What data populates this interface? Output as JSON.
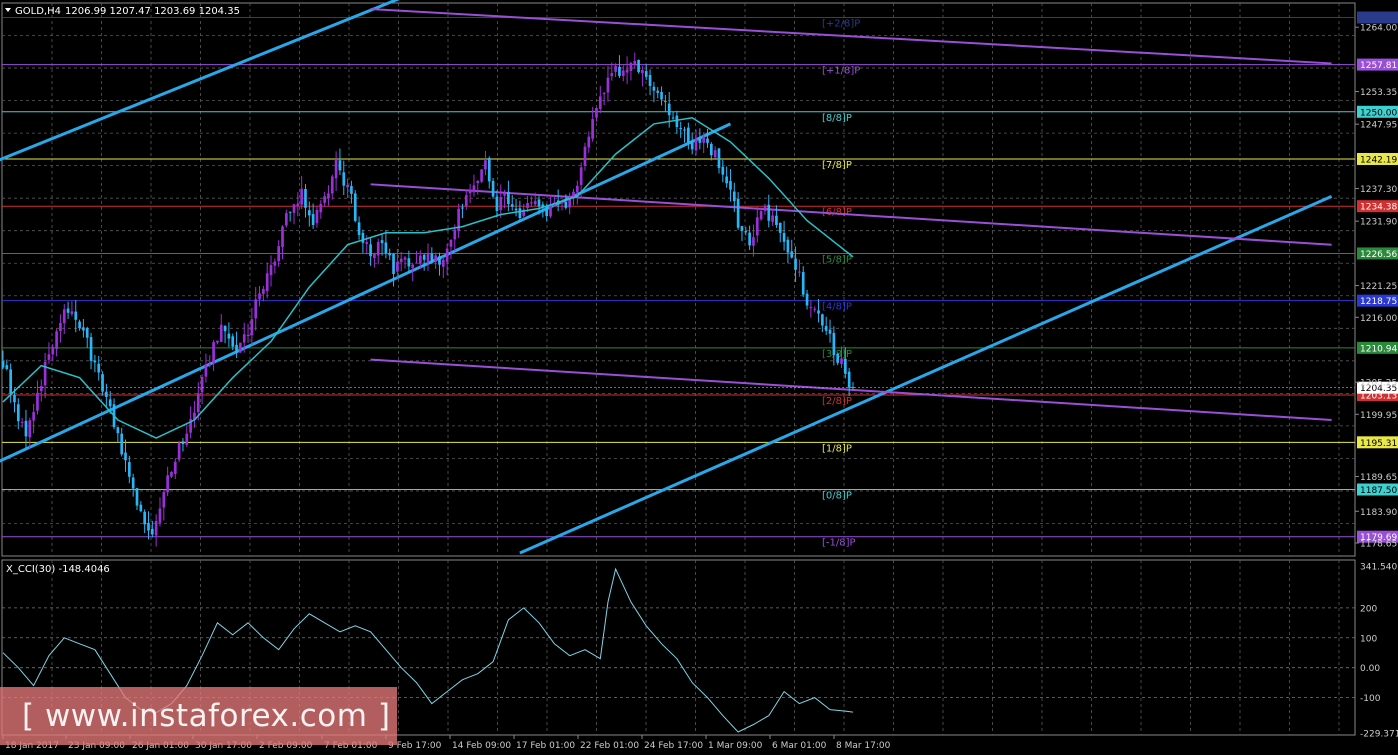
{
  "header": {
    "symbol_tf": "GOLD,H4",
    "ohlc": "1206.99 1207.47 1203.69 1204.35"
  },
  "indicator": {
    "label": "X_CCI(30) -148.4046",
    "value": -148.4046
  },
  "watermark": "[ www.instaforex.com ]",
  "colors": {
    "bull": "#9b30d9",
    "bear": "#29b6f6",
    "trend_channel": "#28a8e8",
    "regression_channel": "#9a4fd8",
    "moving_average": "#29c0c8",
    "cci_line": "#7fd4e8",
    "grid": "#5a5a5a"
  },
  "chart_data": [
    {
      "type": "candlestick",
      "title": "GOLD,H4",
      "ylim": [
        1176.5,
        1268.0
      ],
      "yticks": [
        "1264.00",
        "1253.35",
        "1247.95",
        "1237.30",
        "1231.90",
        "1221.25",
        "1216.00",
        "1205.25",
        "1199.95",
        "1189.65",
        "1183.90",
        "1178.65"
      ],
      "xticks": [
        "18 Jan 2017",
        "23 Jan 09:00",
        "26 Jan 01:00",
        "30 Jan 17:00",
        "2 Feb 09:00",
        "7 Feb 01:00",
        "9 Feb 17:00",
        "14 Feb 09:00",
        "17 Feb 01:00",
        "22 Feb 01:00",
        "24 Feb 17:00",
        "1 Mar 09:00",
        "6 Mar 01:00",
        "8 Mar 17:00"
      ],
      "murrey_levels": [
        {
          "label": "[+2/8]P",
          "price": 1265.6,
          "color": "#2a3a8c",
          "tag": ""
        },
        {
          "label": "[+1/8]P",
          "price": 1257.81,
          "color": "#9a4fd8",
          "tag": "1257.81"
        },
        {
          "label": "[8/8]P",
          "price": 1250.0,
          "color": "#3fd0d0",
          "tag": "1250.00"
        },
        {
          "label": "[7/8]P",
          "price": 1242.19,
          "color": "#e8e84a",
          "tag": "1242.19"
        },
        {
          "label": "[6/8]P",
          "price": 1234.38,
          "color": "#d03030",
          "tag": "1234.38"
        },
        {
          "label": "[5/8]P",
          "price": 1226.56,
          "color": "#2a8a3a",
          "tag": "1226.56"
        },
        {
          "label": "[4/8]P",
          "price": 1218.75,
          "color": "#2a3ad0",
          "tag": "1218.75"
        },
        {
          "label": "[3/8]P",
          "price": 1210.94,
          "color": "#2a8a3a",
          "tag": "1210.94"
        },
        {
          "label": "[2/8]P",
          "price": 1203.13,
          "color": "#d03030",
          "tag": "1203.13"
        },
        {
          "label": "[1/8]P",
          "price": 1195.31,
          "color": "#e8e84a",
          "tag": "1195.31"
        },
        {
          "label": "[0/8]P",
          "price": 1187.5,
          "color": "#3fd0d0",
          "tag": "1187.50"
        },
        {
          "label": "[-1/8]P",
          "price": 1179.69,
          "color": "#9a4fd8",
          "tag": "1179.69"
        }
      ],
      "current_price": "1204.35",
      "close_path": [
        [
          0,
          1209
        ],
        [
          3,
          1202
        ],
        [
          6,
          1196
        ],
        [
          9,
          1203
        ],
        [
          12,
          1210
        ],
        [
          15,
          1216
        ],
        [
          18,
          1217
        ],
        [
          21,
          1213
        ],
        [
          24,
          1208
        ],
        [
          27,
          1202
        ],
        [
          30,
          1196
        ],
        [
          33,
          1190
        ],
        [
          36,
          1183
        ],
        [
          39,
          1181
        ],
        [
          42,
          1187
        ],
        [
          45,
          1193
        ],
        [
          48,
          1197
        ],
        [
          51,
          1203
        ],
        [
          54,
          1209
        ],
        [
          57,
          1214
        ],
        [
          60,
          1210
        ],
        [
          63,
          1212
        ],
        [
          66,
          1218
        ],
        [
          69,
          1222
        ],
        [
          72,
          1228
        ],
        [
          75,
          1234
        ],
        [
          78,
          1236
        ],
        [
          81,
          1232
        ],
        [
          84,
          1236
        ],
        [
          87,
          1241
        ],
        [
          90,
          1238
        ],
        [
          93,
          1230
        ],
        [
          96,
          1226
        ],
        [
          99,
          1228
        ],
        [
          102,
          1224
        ],
        [
          105,
          1226
        ],
        [
          108,
          1225
        ],
        [
          111,
          1227
        ],
        [
          114,
          1224
        ],
        [
          117,
          1230
        ],
        [
          120,
          1235
        ],
        [
          123,
          1239
        ],
        [
          126,
          1241
        ],
        [
          129,
          1234
        ],
        [
          132,
          1236
        ],
        [
          135,
          1232
        ],
        [
          138,
          1235
        ],
        [
          141,
          1233
        ],
        [
          144,
          1236
        ],
        [
          147,
          1234
        ],
        [
          150,
          1238
        ],
        [
          153,
          1246
        ],
        [
          156,
          1252
        ],
        [
          159,
          1256
        ],
        [
          162,
          1257
        ],
        [
          165,
          1258
        ],
        [
          168,
          1256
        ],
        [
          171,
          1253
        ],
        [
          174,
          1250
        ],
        [
          177,
          1247
        ],
        [
          180,
          1244
        ],
        [
          183,
          1246
        ],
        [
          186,
          1243
        ],
        [
          189,
          1238
        ],
        [
          192,
          1232
        ],
        [
          195,
          1228
        ],
        [
          198,
          1234
        ],
        [
          201,
          1232
        ],
        [
          204,
          1228
        ],
        [
          207,
          1225
        ],
        [
          210,
          1219
        ],
        [
          213,
          1216
        ],
        [
          216,
          1212
        ],
        [
          219,
          1208
        ],
        [
          222,
          1204.35
        ]
      ],
      "moving_average_path": [
        [
          0,
          1202
        ],
        [
          10,
          1208
        ],
        [
          20,
          1206
        ],
        [
          30,
          1199
        ],
        [
          40,
          1196
        ],
        [
          50,
          1199
        ],
        [
          60,
          1206
        ],
        [
          70,
          1212
        ],
        [
          80,
          1221
        ],
        [
          90,
          1228
        ],
        [
          100,
          1230
        ],
        [
          110,
          1230
        ],
        [
          120,
          1231
        ],
        [
          130,
          1233
        ],
        [
          140,
          1234
        ],
        [
          150,
          1236
        ],
        [
          160,
          1243
        ],
        [
          170,
          1248
        ],
        [
          180,
          1249
        ],
        [
          190,
          1245
        ],
        [
          200,
          1239
        ],
        [
          210,
          1232
        ],
        [
          222,
          1226
        ]
      ],
      "trend_channel": {
        "upper": [
          [
            -5,
            1241
          ],
          [
            222,
            1299
          ]
        ],
        "middle": [
          [
            -5,
            1191
          ],
          [
            190,
            1248
          ]
        ],
        "lower": [
          [
            135,
            1177
          ],
          [
            347,
            1236
          ]
        ]
      },
      "regression_channel": {
        "upper": [
          [
            96,
            1267
          ],
          [
            347,
            1258
          ]
        ],
        "middle": [
          [
            96,
            1238
          ],
          [
            347,
            1228
          ]
        ],
        "lower": [
          [
            96,
            1209
          ],
          [
            347,
            1199
          ]
        ]
      }
    },
    {
      "type": "line",
      "title": "X_CCI(30) -148.4046",
      "ylim": [
        -225,
        360
      ],
      "yticks": [
        "341.5407",
        "200",
        "100",
        "0.00",
        "-100",
        "-229.3715"
      ],
      "levels": [
        200,
        100,
        0,
        -100
      ],
      "path": [
        [
          0,
          50
        ],
        [
          4,
          0
        ],
        [
          8,
          -60
        ],
        [
          12,
          40
        ],
        [
          16,
          100
        ],
        [
          20,
          80
        ],
        [
          24,
          60
        ],
        [
          28,
          -20
        ],
        [
          32,
          -100
        ],
        [
          36,
          -140
        ],
        [
          40,
          -150
        ],
        [
          44,
          -120
        ],
        [
          48,
          -60
        ],
        [
          52,
          40
        ],
        [
          56,
          150
        ],
        [
          60,
          110
        ],
        [
          64,
          150
        ],
        [
          68,
          100
        ],
        [
          72,
          60
        ],
        [
          76,
          130
        ],
        [
          80,
          180
        ],
        [
          84,
          150
        ],
        [
          88,
          120
        ],
        [
          92,
          140
        ],
        [
          96,
          120
        ],
        [
          100,
          60
        ],
        [
          104,
          0
        ],
        [
          108,
          -50
        ],
        [
          112,
          -120
        ],
        [
          116,
          -80
        ],
        [
          120,
          -40
        ],
        [
          124,
          -20
        ],
        [
          128,
          20
        ],
        [
          132,
          160
        ],
        [
          136,
          200
        ],
        [
          140,
          150
        ],
        [
          144,
          80
        ],
        [
          148,
          40
        ],
        [
          152,
          60
        ],
        [
          156,
          30
        ],
        [
          158,
          220
        ],
        [
          160,
          330
        ],
        [
          164,
          220
        ],
        [
          168,
          140
        ],
        [
          172,
          80
        ],
        [
          176,
          30
        ],
        [
          180,
          -50
        ],
        [
          184,
          -100
        ],
        [
          188,
          -160
        ],
        [
          192,
          -215
        ],
        [
          196,
          -190
        ],
        [
          200,
          -160
        ],
        [
          204,
          -80
        ],
        [
          208,
          -120
        ],
        [
          212,
          -100
        ],
        [
          216,
          -140
        ],
        [
          220,
          -145
        ],
        [
          222,
          -148.4
        ]
      ]
    }
  ]
}
